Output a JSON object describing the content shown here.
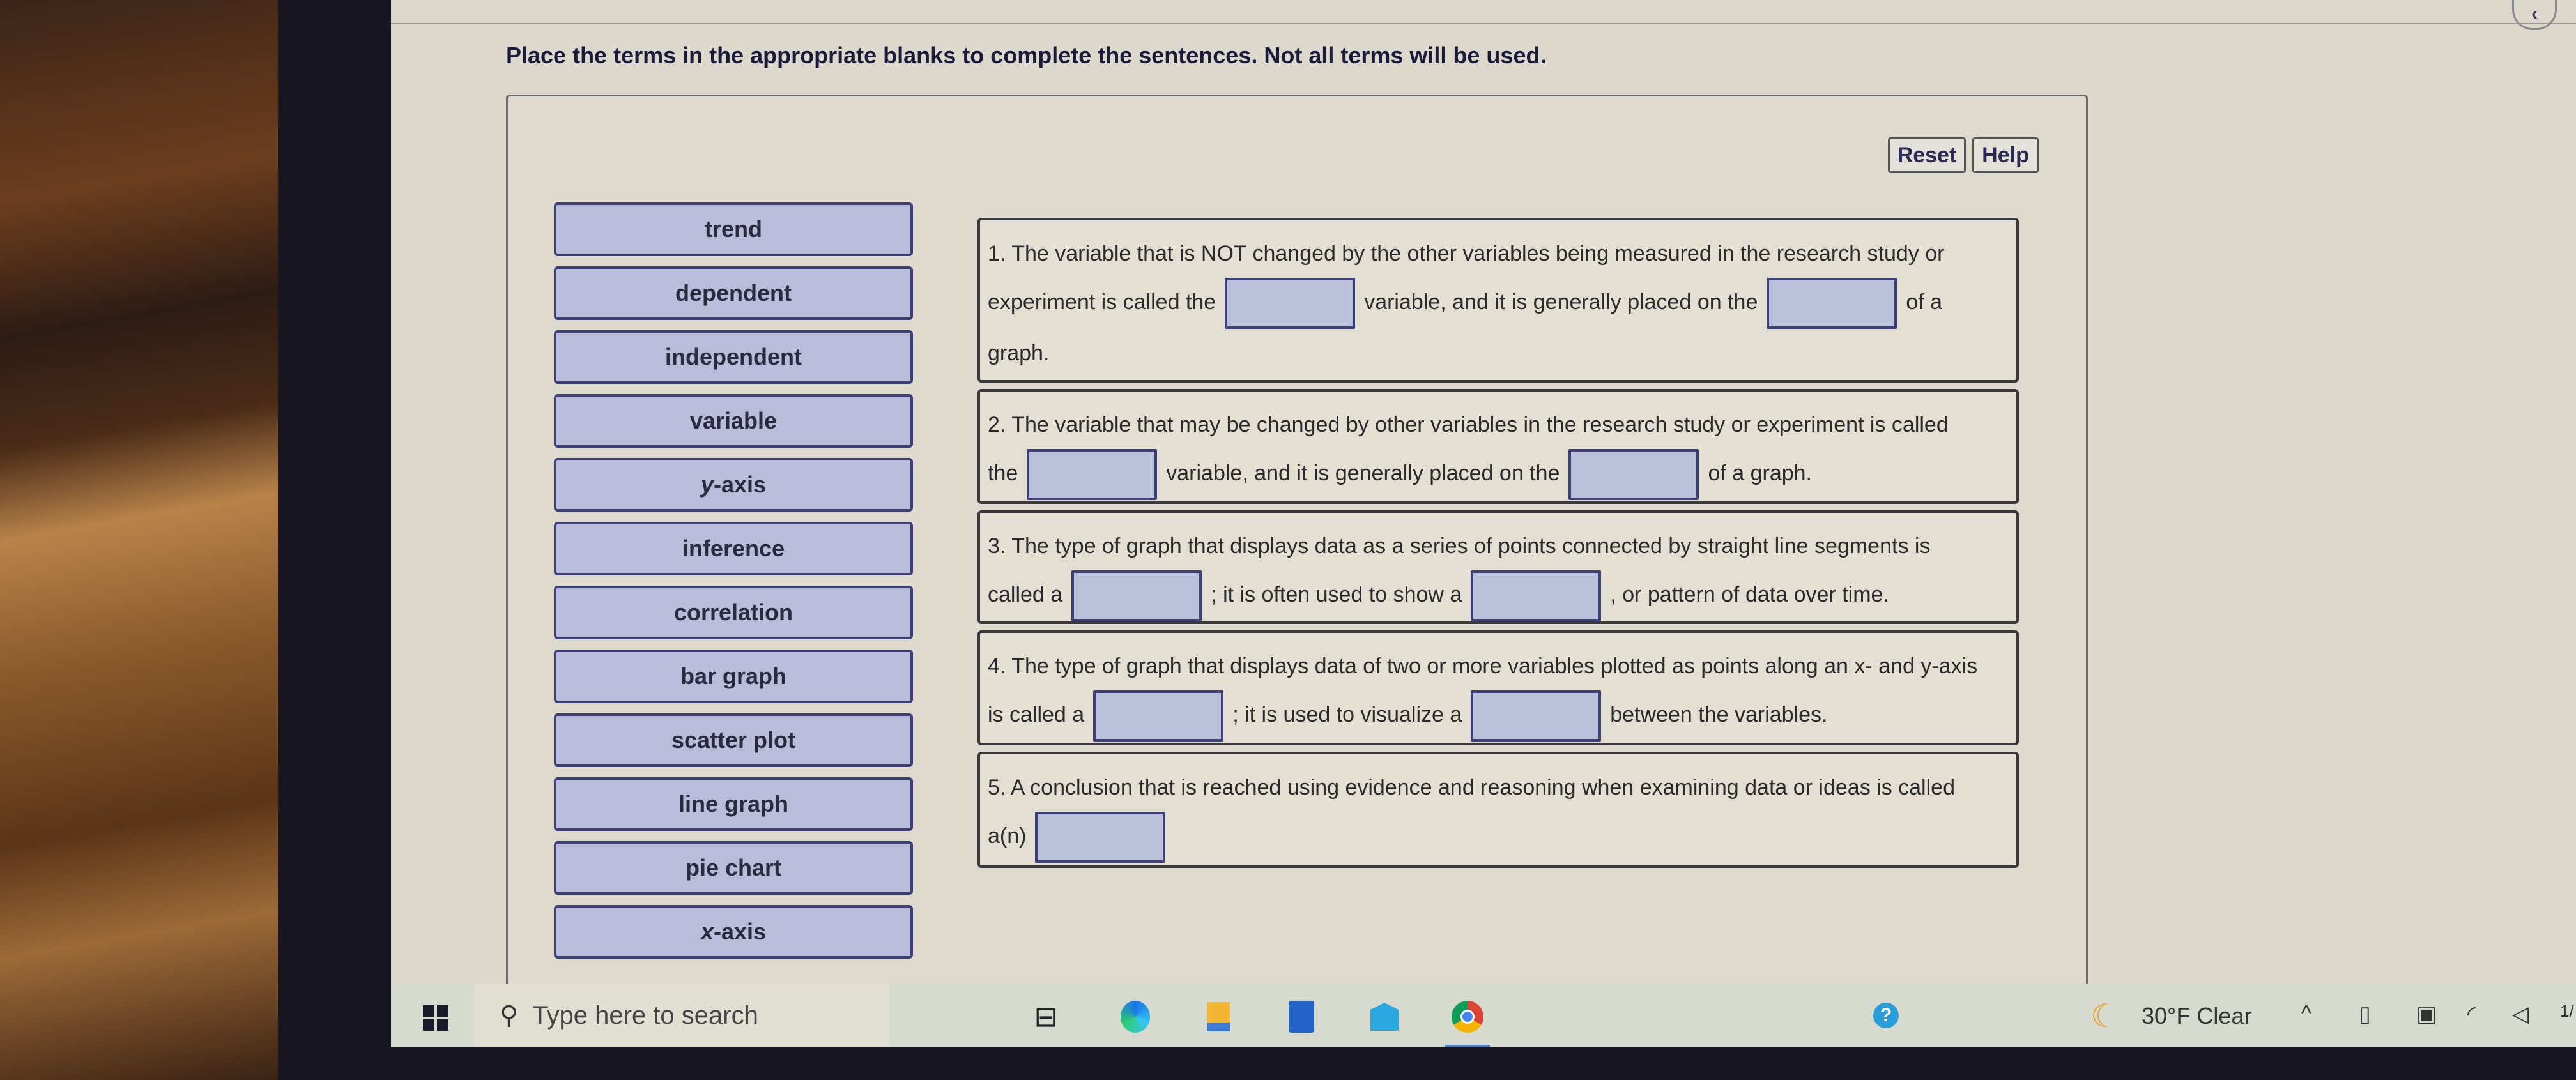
{
  "instructions": "Place the terms in the appropriate blanks to complete the sentences. Not all terms will be used.",
  "toolbar": {
    "reset_label": "Reset",
    "help_label": "Help"
  },
  "nav": {
    "back_icon": "‹"
  },
  "terms": [
    "trend",
    "dependent",
    "independent",
    "variable",
    "y-axis",
    "inference",
    "correlation",
    "bar graph",
    "scatter plot",
    "line graph",
    "pie chart",
    "x-axis"
  ],
  "questions": {
    "q1": {
      "line1": "1. The variable that is NOT changed by the other variables being measured in the research study or",
      "a": "experiment is called the",
      "b": "variable, and it is generally placed on the",
      "c": "of a",
      "line3": "graph."
    },
    "q2": {
      "line1": "2. The variable that may be changed by other variables in the research study or experiment is called",
      "a": "the",
      "b": "variable, and it is generally placed on the",
      "c": "of a graph."
    },
    "q3": {
      "line1": "3. The type of graph that displays data as a series of points connected by straight line segments is",
      "a": "called a",
      "b": "; it is often used to show a",
      "c": ", or pattern of data over time."
    },
    "q4": {
      "line1": "4. The type of graph that displays data of two or more variables plotted as points along an x- and y-axis",
      "a": "is called a",
      "b": "; it is used to visualize a",
      "c": "between the variables."
    },
    "q5": {
      "line1": "5. A conclusion that is reached using evidence and reasoning when examining data or ideas is called",
      "a": "a(n)"
    }
  },
  "taskbar": {
    "search_placeholder": "Type here to search",
    "weather": "30°F  Clear",
    "help_glyph": "?",
    "time_partial": "1/"
  },
  "colors": {
    "term_fill": "#b9bdd9",
    "term_border": "#3c3f78",
    "blank_fill": "#bcc1db",
    "page_bg": "#dcd9cc"
  }
}
